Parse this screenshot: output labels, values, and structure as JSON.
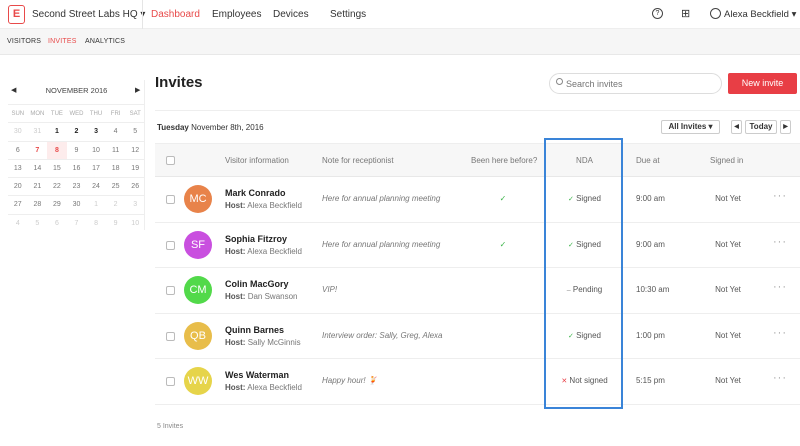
{
  "topnav": {
    "logo": "E",
    "org": "Second Street Labs HQ ▾",
    "links": [
      "Dashboard",
      "Employees",
      "Devices",
      "Settings"
    ],
    "active": "Dashboard",
    "user": "Alexa Beckfield ▾",
    "icons": [
      "help-icon",
      "gift-icon",
      "user-circle-icon"
    ]
  },
  "subnav": {
    "items": [
      "VISITORS",
      "INVITES",
      "ANALYTICS"
    ],
    "active": "INVITES"
  },
  "calendar": {
    "month": "NOVEMBER 2016",
    "prev": "◀",
    "next": "▶",
    "weekdays": [
      "SUN",
      "MON",
      "TUE",
      "WED",
      "THU",
      "FRI",
      "SAT"
    ],
    "days": [
      "30",
      "31",
      "1",
      "2",
      "3",
      "4",
      "5",
      "6",
      "7",
      "8",
      "9",
      "10",
      "11",
      "12",
      "13",
      "14",
      "15",
      "16",
      "17",
      "18",
      "19",
      "20",
      "21",
      "22",
      "23",
      "24",
      "25",
      "26",
      "27",
      "28",
      "29",
      "30",
      "1",
      "2",
      "3",
      "4",
      "5",
      "6",
      "7",
      "8",
      "9",
      "10"
    ],
    "selected": "8",
    "today": "7"
  },
  "main": {
    "title": "Invites",
    "search_placeholder": "Search invites",
    "new_invite": "New invite",
    "date_day": "Tuesday",
    "date_rest": "November 8th, 2016",
    "filter": "All Invites ▾",
    "prev": "◀",
    "today": "Today",
    "next": "▶",
    "columns": [
      "Visitor information",
      "Note for receptionist",
      "Been here before?",
      "NDA",
      "Due at",
      "Signed in"
    ],
    "rows": [
      {
        "initials": "MC",
        "color": "#e8834a",
        "name": "Mark Conrado",
        "host_label": "Host:",
        "host": "Alexa Beckfield",
        "note": "Here for annual planning meeting",
        "been": "✓",
        "nda_icon": "✓",
        "nda": "Signed",
        "due": "9:00 am",
        "signed_in": "Not Yet"
      },
      {
        "initials": "SF",
        "color": "#c94fdf",
        "name": "Sophia Fitzroy",
        "host_label": "Host:",
        "host": "Alexa Beckfield",
        "note": "Here for annual planning meeting",
        "been": "✓",
        "nda_icon": "✓",
        "nda": "Signed",
        "due": "9:00 am",
        "signed_in": "Not Yet"
      },
      {
        "initials": "CM",
        "color": "#52d94a",
        "name": "Colin MacGory",
        "host_label": "Host:",
        "host": "Dan Swanson",
        "note": "VIP!",
        "been": "",
        "nda_icon": "–",
        "nda": "Pending",
        "due": "10:30 am",
        "signed_in": "Not Yet"
      },
      {
        "initials": "QB",
        "color": "#e8bd4a",
        "name": "Quinn Barnes",
        "host_label": "Host:",
        "host": "Sally McGinnis",
        "note": "Interview order: Sally, Greg, Alexa",
        "been": "",
        "nda_icon": "✓",
        "nda": "Signed",
        "due": "1:00 pm",
        "signed_in": "Not Yet"
      },
      {
        "initials": "WW",
        "color": "#e6d44a",
        "name": "Wes Waterman",
        "host_label": "Host:",
        "host": "Alexa Beckfield",
        "note": "Happy hour! 🍹",
        "been": "",
        "nda_icon": "✕",
        "nda": "Not signed",
        "due": "5:15 pm",
        "signed_in": "Not Yet"
      }
    ],
    "count": "5 Invites"
  },
  "colors": {
    "accent": "#e83e45",
    "highlight": "#3a84d8",
    "check": "#3cb54a"
  }
}
